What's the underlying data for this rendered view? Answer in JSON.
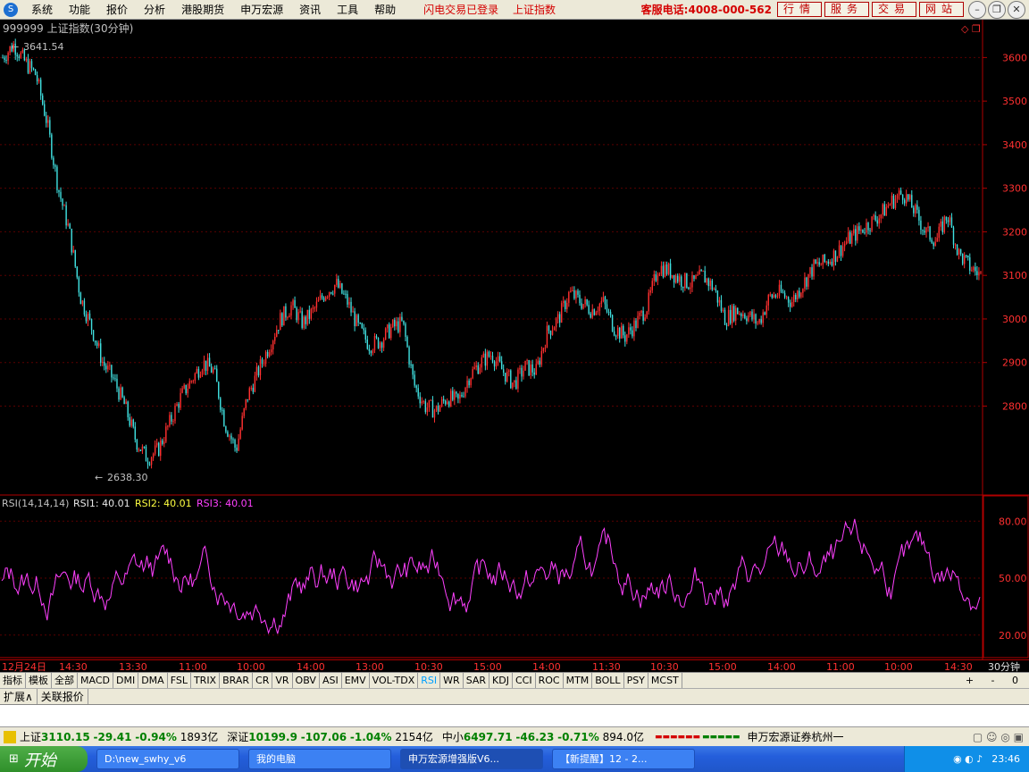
{
  "menu": {
    "items": [
      "系统",
      "功能",
      "报价",
      "分析",
      "港股期货",
      "申万宏源",
      "资讯",
      "工具",
      "帮助"
    ],
    "login_status": "闪电交易已登录",
    "index_name": "上证指数",
    "hotline": "客服电话:4008-000-562",
    "buttons": [
      "行情",
      "服务",
      "交易",
      "网站"
    ]
  },
  "chart": {
    "title": "999999 上证指数(30分钟)",
    "high_label": "3641.54",
    "low_label": "2638.30",
    "y_ticks": [
      "3600",
      "3500",
      "3400",
      "3300",
      "3200",
      "3100",
      "3000",
      "2900",
      "2800"
    ],
    "rsi_title": "RSI(14,14,14)",
    "rsi1": "RSI1: 40.01",
    "rsi2": "RSI2: 40.01",
    "rsi3": "RSI3: 40.01",
    "rsi_ticks": [
      "80.00",
      "50.00",
      "20.00"
    ],
    "x_labels": [
      "12月24日",
      "14:30",
      "13:30",
      "11:00",
      "10:00",
      "14:00",
      "13:00",
      "10:30",
      "15:00",
      "14:00",
      "11:30",
      "10:30",
      "15:00",
      "14:00",
      "11:00",
      "10:00",
      "14:30"
    ],
    "period": "30分钟",
    "colors": {
      "up": "#ff3030",
      "down": "#40e0e0",
      "rsi": "#ff40ff",
      "axis": "#b00000"
    }
  },
  "chart_data": {
    "type": "candlestick",
    "series": [
      {
        "name": "上证指数",
        "values": [
          3600,
          3630,
          3590,
          3560,
          3450,
          3300,
          3200,
          3050,
          2980,
          2900,
          2860,
          2800,
          2720,
          2680,
          2700,
          2760,
          2820,
          2860,
          2900,
          2880,
          2760,
          2700,
          2820,
          2880,
          2940,
          3000,
          3030,
          2990,
          3020,
          3060,
          3080,
          3040,
          2980,
          2940,
          2950,
          2980,
          2990,
          2850,
          2800,
          2790,
          2820,
          2810,
          2870,
          2900,
          2920,
          2880,
          2850,
          2890,
          2880,
          2970,
          3000,
          3060,
          3040,
          3020,
          3040,
          2980,
          2960,
          2990,
          3030,
          3120,
          3110,
          3090,
          3080,
          3100,
          3070,
          3000,
          3020,
          3010,
          2990,
          3050,
          3060,
          3040,
          3080,
          3120,
          3130,
          3150,
          3180,
          3200,
          3220,
          3240,
          3270,
          3290,
          3250,
          3200,
          3180,
          3240,
          3150,
          3120,
          3100
        ]
      }
    ],
    "ylim": [
      2600,
      3650
    ]
  },
  "tabs": [
    "指标",
    "模板",
    "全部",
    "MACD",
    "DMI",
    "DMA",
    "FSL",
    "TRIX",
    "BRAR",
    "CR",
    "VR",
    "OBV",
    "ASI",
    "EMV",
    "VOL-TDX",
    "RSI",
    "WR",
    "SAR",
    "KDJ",
    "CCI",
    "ROC",
    "MTM",
    "BOLL",
    "PSY",
    "MCST"
  ],
  "active_tab": "RSI",
  "subtabs": [
    "扩展∧",
    "关联报价"
  ],
  "ticker": {
    "sh_label": "上证",
    "sh_val": "3110.15",
    "sh_chg": "-29.41",
    "sh_pct": "-0.94%",
    "sh_amt": "1893亿",
    "sz_label": "深证",
    "sz_val": "10199.9",
    "sz_chg": "-107.06",
    "sz_pct": "-1.04%",
    "sz_amt": "2154亿",
    "zx_label": "中小",
    "zx_val": "6497.71",
    "zx_chg": "-46.23",
    "zx_pct": "-0.71%",
    "zx_amt": "894.0亿",
    "broker": "申万宏源证券杭州一"
  },
  "taskbar": {
    "start": "开始",
    "tasks": [
      "D:\\new_swhy_v6",
      "我的电脑",
      "申万宏源增强版V6...",
      "【新提醒】12 - 2..."
    ],
    "clock": "23:46"
  }
}
